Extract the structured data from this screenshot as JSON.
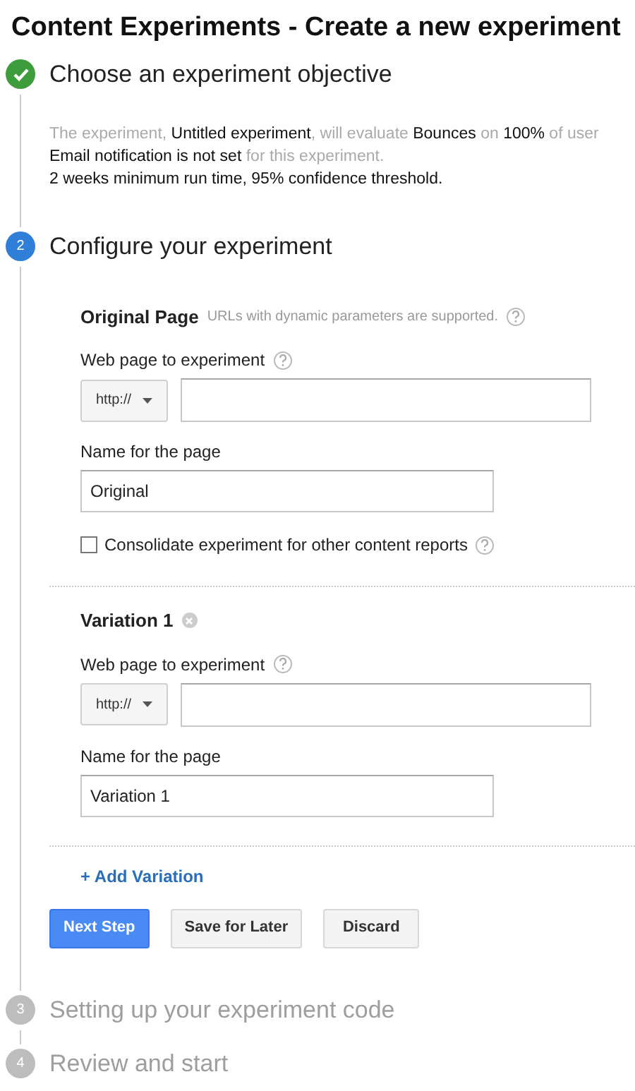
{
  "title": "Content Experiments - Create a new experiment",
  "steps": [
    {
      "label": "Choose an experiment objective",
      "completed": true,
      "summary": [
        "The experiment, **Untitled experiment**, will evaluate **Bounces** on **100%** of user",
        "**Email notification is not set** for this experiment.",
        "**2 weeks minimum run time, 95% confidence threshold.**"
      ]
    },
    {
      "number": "2",
      "label": "Configure your experiment",
      "completed": false,
      "current": true
    },
    {
      "number": "3",
      "label": "Setting up your experiment code",
      "completed": false,
      "current": false
    },
    {
      "number": "4",
      "label": "Review and start",
      "completed": false,
      "current": false
    }
  ],
  "pages": [
    {
      "title": "Original Page",
      "note": "URLs with dynamic parameters are supported.",
      "removable": false,
      "url_label": "Web page to experiment",
      "protocol": "http://",
      "name_label": "Name for the page",
      "name_value": "Original",
      "consolidate": {
        "label": "Consolidate experiment for other content reports",
        "checked": false
      }
    },
    {
      "title": "Variation 1",
      "removable": true,
      "url_label": "Web page to experiment",
      "protocol": "http://",
      "name_label": "Name for the page",
      "name_value": "Variation 1"
    }
  ],
  "add_variation": "+ Add Variation",
  "buttons": [
    {
      "label": "Next Step",
      "kind": "primary"
    },
    {
      "label": "Save for Later",
      "kind": "secondary"
    },
    {
      "label": "Discard",
      "kind": "secondary"
    }
  ]
}
